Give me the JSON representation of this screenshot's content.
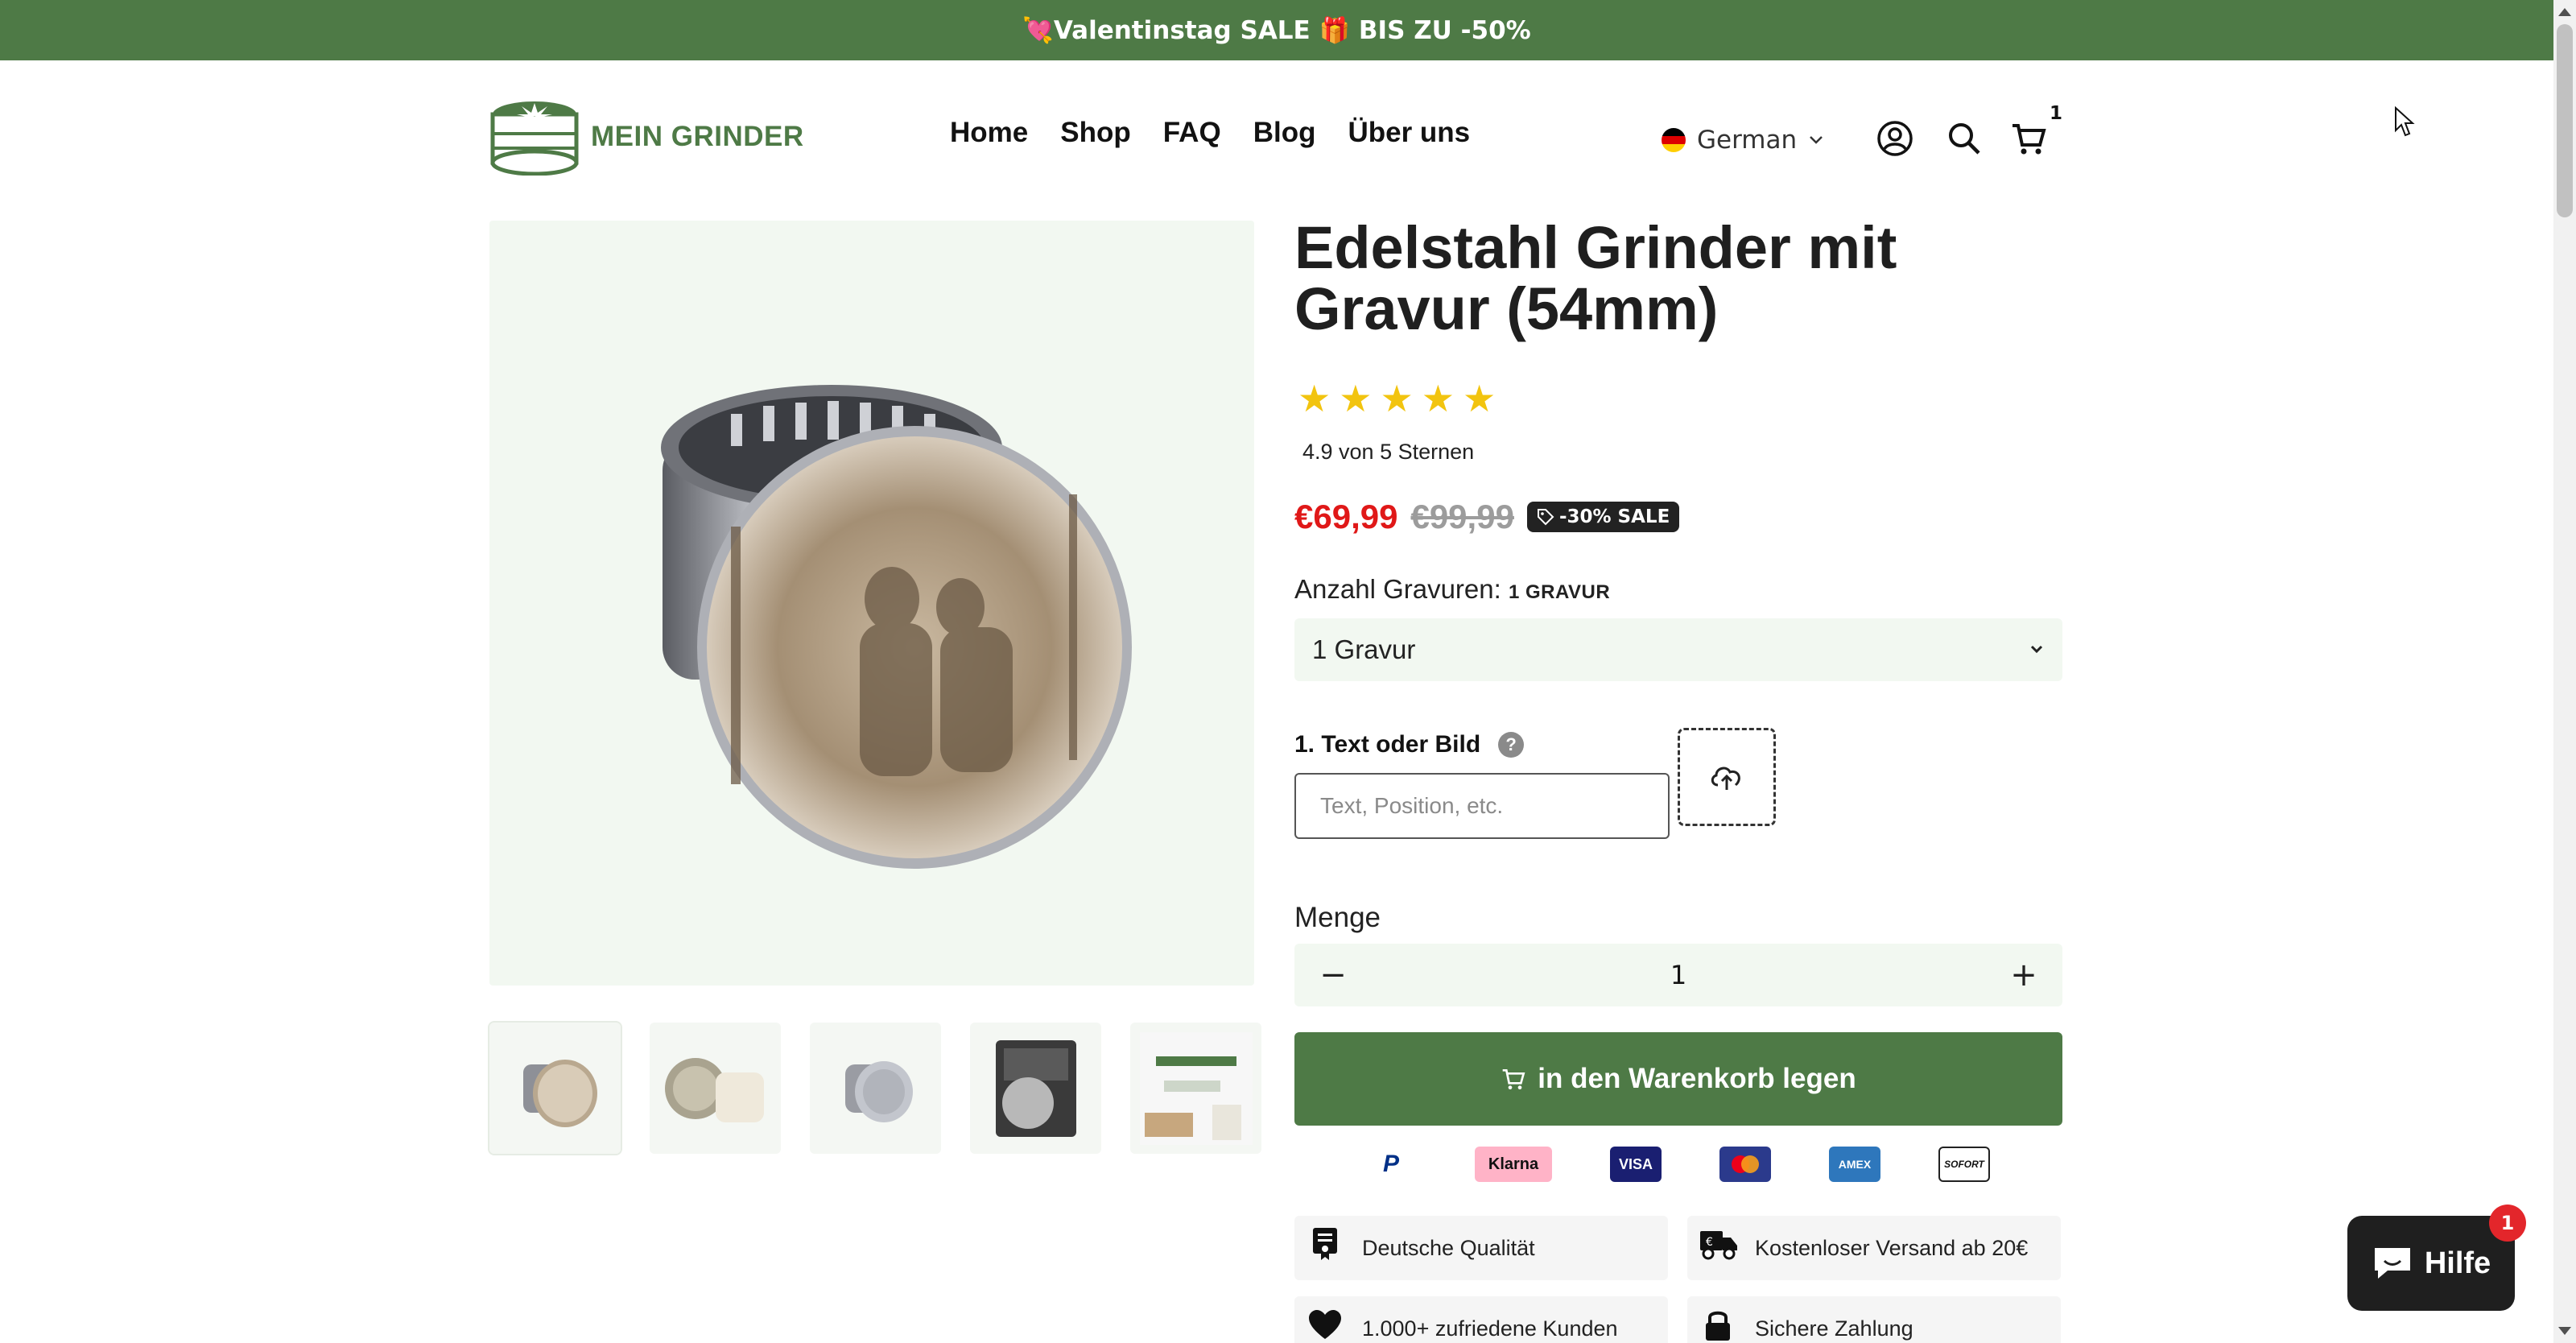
{
  "announcement": {
    "text": "💘Valentinstag SALE 🎁 BIS ZU -50%"
  },
  "header": {
    "logo_text": "MEIN GRINDER",
    "nav": [
      "Home",
      "Shop",
      "FAQ",
      "Blog",
      "Über uns"
    ],
    "language": "German",
    "cart_count": "1"
  },
  "product": {
    "title": "Edelstahl Grinder mit Gravur (54mm)",
    "rating": 4.9,
    "rating_max": 5,
    "rating_text": "4.9 von 5 Sternen",
    "price": "€69,99",
    "compare_price": "€99,99",
    "sale_badge": "-30% SALE",
    "option_label": "Anzahl Gravuren:",
    "option_value": "1 GRAVUR",
    "select_value": "1 Gravur",
    "engraving_label": "1. Text oder Bild",
    "help_glyph": "?",
    "engraving_placeholder": "Text, Position, etc.",
    "quantity_label": "Menge",
    "quantity": "1",
    "minus_glyph": "−",
    "plus_glyph": "+",
    "add_to_cart": "in den Warenkorb legen"
  },
  "payments": [
    {
      "name": "PayPal",
      "label": "P",
      "color": "#003087"
    },
    {
      "name": "Klarna",
      "label": "Klarna",
      "color": "#ffb3c7"
    },
    {
      "name": "Visa",
      "label": "VISA",
      "color": "#1a1f71"
    },
    {
      "name": "Mastercard",
      "label": "",
      "color": "#eb001b"
    },
    {
      "name": "American Express",
      "label": "AMEX",
      "color": "#2e77bc"
    },
    {
      "name": "Sofort",
      "label": "SOFORT",
      "color": "#ffffff"
    }
  ],
  "features": [
    {
      "icon": "certificate-icon",
      "text": "Deutsche Qualität"
    },
    {
      "icon": "truck-icon",
      "text": "Kostenloser Versand ab 20€"
    },
    {
      "icon": "heart-icon",
      "text": "1.000+ zufriedene Kunden"
    },
    {
      "icon": "lock-icon",
      "text": "Sichere Zahlung"
    }
  ],
  "chat": {
    "label": "Hilfe",
    "badge": "1"
  },
  "colors": {
    "brand": "#4e7a46",
    "sale": "#e01818",
    "star": "#f2c40f"
  }
}
